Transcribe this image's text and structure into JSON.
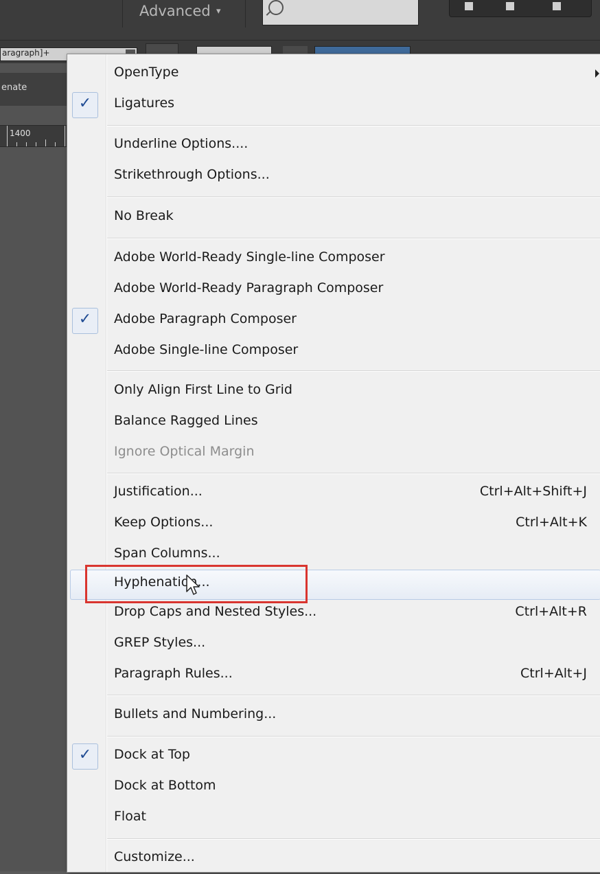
{
  "app": {
    "workspace_label": "Advanced",
    "workspace_caret": "▾",
    "paragraph_style": "aragraph]+",
    "panel_label": "enate",
    "ruler_value": "1400"
  },
  "menu": {
    "items": [
      {
        "label": "OpenType",
        "submenu": true
      },
      {
        "label": "Ligatures",
        "checked": true
      },
      {
        "label": "Underline Options...."
      },
      {
        "label": "Strikethrough Options..."
      },
      {
        "label": "No Break"
      },
      {
        "label": "Adobe World-Ready Single-line Composer"
      },
      {
        "label": "Adobe World-Ready Paragraph Composer"
      },
      {
        "label": "Adobe Paragraph Composer",
        "checked": true
      },
      {
        "label": "Adobe Single-line Composer"
      },
      {
        "label": "Only Align First Line to Grid"
      },
      {
        "label": "Balance Ragged Lines"
      },
      {
        "label": "Ignore Optical Margin",
        "disabled": true
      },
      {
        "label": "Justification...",
        "shortcut": "Ctrl+Alt+Shift+J"
      },
      {
        "label": "Keep Options...",
        "shortcut": "Ctrl+Alt+K"
      },
      {
        "label": "Span Columns..."
      },
      {
        "label": "Hyphenation...",
        "hovered": true,
        "highlighted": true
      },
      {
        "label": "Drop Caps and Nested Styles...",
        "shortcut": "Ctrl+Alt+R"
      },
      {
        "label": "GREP Styles..."
      },
      {
        "label": "Paragraph Rules...",
        "shortcut": "Ctrl+Alt+J"
      },
      {
        "label": "Bullets and Numbering..."
      },
      {
        "label": "Dock at Top",
        "checked": true
      },
      {
        "label": "Dock at Bottom"
      },
      {
        "label": "Float"
      },
      {
        "label": "Customize..."
      }
    ],
    "check_glyph": "✓"
  },
  "colors": {
    "menu_bg": "#f0f0f0",
    "highlight_box": "#d9352f",
    "check_color": "#1f4b93",
    "app_chrome": "#3c3c3c"
  }
}
